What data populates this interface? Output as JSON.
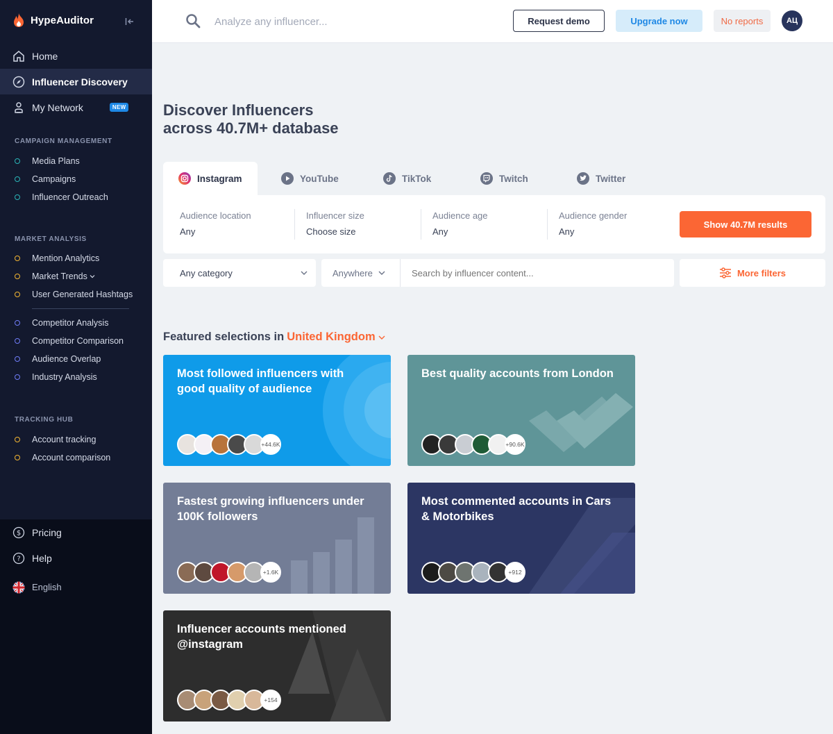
{
  "app": {
    "name": "HypeAuditor"
  },
  "sidebar": {
    "main": [
      {
        "label": "Home",
        "icon": "home-icon"
      },
      {
        "label": "Influencer Discovery",
        "icon": "compass-icon"
      },
      {
        "label": "My Network",
        "icon": "network-icon",
        "badge": "NEW"
      }
    ],
    "campaign_title": "CAMPAIGN MANAGEMENT",
    "campaign": [
      "Media Plans",
      "Campaigns",
      "Influencer Outreach"
    ],
    "market_title": "MARKET ANALYSIS",
    "market": [
      "Mention Analytics",
      "Market Trends",
      "User Generated Hashtags"
    ],
    "competitor": [
      "Competitor Analysis",
      "Competitor Comparison",
      "Audience Overlap",
      "Industry Analysis"
    ],
    "tracking_title": "TRACKING HUB",
    "tracking": [
      "Account tracking",
      "Account comparison"
    ],
    "bottom": [
      {
        "label": "Pricing",
        "icon": "dollar-icon"
      },
      {
        "label": "Help",
        "icon": "help-icon"
      },
      {
        "label": "English",
        "icon": "uk-flag-icon"
      }
    ]
  },
  "topbar": {
    "search_placeholder": "Analyze any influencer...",
    "request_demo": "Request demo",
    "upgrade": "Upgrade now",
    "reports": "No reports",
    "avatar": "АЦ"
  },
  "main": {
    "title_line1": "Discover Influencers",
    "title_line2": "across 40.7M+ database",
    "tabs": [
      "Instagram",
      "YouTube",
      "TikTok",
      "Twitch",
      "Twitter"
    ],
    "filters": [
      {
        "label": "Audience location",
        "value": "Any"
      },
      {
        "label": "Influencer size",
        "value": "Choose size"
      },
      {
        "label": "Audience age",
        "value": "Any"
      },
      {
        "label": "Audience gender",
        "value": "Any"
      }
    ],
    "show_results": "Show 40.7M results",
    "category": "Any category",
    "location": "Anywhere",
    "content_placeholder": "Search by influencer content...",
    "more_filters": "More filters",
    "featured_prefix": "Featured selections in",
    "featured_location": "United Kingdom"
  },
  "cards": [
    {
      "title": "Most followed influencers with good quality of audience",
      "more": "+44.6K",
      "color": "#0f9be9"
    },
    {
      "title": "Best quality accounts from London",
      "more": "+90.6K",
      "color": "#5f9598"
    },
    {
      "title": "Fastest growing influencers under 100K followers",
      "more": "+1.6K",
      "color": "#737d96"
    },
    {
      "title": "Most commented accounts in Cars & Motorbikes",
      "more": "+912",
      "color": "#2c3663"
    },
    {
      "title": "Influencer accounts mentioned @instagram",
      "more": "+154",
      "color": "#2d2d2d"
    }
  ]
}
